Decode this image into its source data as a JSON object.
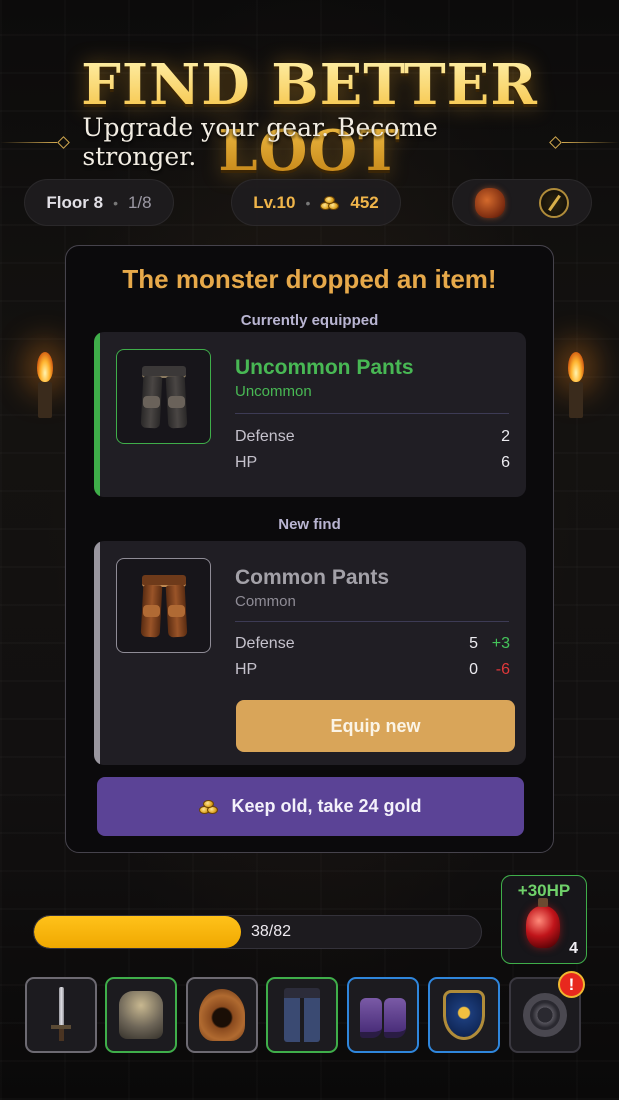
{
  "header": {
    "title": "FIND BETTER LOOT",
    "subtitle": "Upgrade your gear. Become stronger."
  },
  "status": {
    "floor_label": "Floor 8",
    "floor_progress": "1/8",
    "level": "Lv.10",
    "gold": "452",
    "bag_icon": "loot-bag-icon",
    "map_icon": "compass-icon"
  },
  "panel": {
    "title": "The monster dropped an item!",
    "equipped_label": "Currently equipped",
    "new_label": "New find",
    "equipped": {
      "name": "Uncommon Pants",
      "rarity": "Uncommon",
      "rarity_color": "#48b854",
      "stats": [
        {
          "name": "Defense",
          "value": "2"
        },
        {
          "name": "HP",
          "value": "6"
        }
      ]
    },
    "new_item": {
      "name": "Common Pants",
      "rarity": "Common",
      "rarity_color": "#a3a1a8",
      "stats": [
        {
          "name": "Defense",
          "value": "5",
          "delta": "+3"
        },
        {
          "name": "HP",
          "value": "0",
          "delta": "-6"
        }
      ]
    },
    "equip_button": "Equip new",
    "keep_button": "Keep old, take 24 gold"
  },
  "hud": {
    "hp_text": "38/82",
    "hp_fraction": 0.4634,
    "potion_label": "+30HP",
    "potion_count": "4",
    "alert_badge": "!"
  },
  "equipment_slots": [
    {
      "name": "sword",
      "rarity": "common"
    },
    {
      "name": "chest-armor",
      "rarity": "uncommon"
    },
    {
      "name": "hood",
      "rarity": "common"
    },
    {
      "name": "pants",
      "rarity": "uncommon"
    },
    {
      "name": "boots",
      "rarity": "rare"
    },
    {
      "name": "shield",
      "rarity": "rare"
    },
    {
      "name": "ring",
      "rarity": "locked"
    }
  ],
  "colors": {
    "gold_accent": "#f0b54a",
    "uncommon": "#3fae4a",
    "rare": "#2f86dc",
    "equip_button": "#d9a559",
    "keep_button": "#5b4396",
    "hp_bar": "#ffc21a",
    "delta_up": "#44c45a",
    "delta_down": "#e0383a"
  }
}
